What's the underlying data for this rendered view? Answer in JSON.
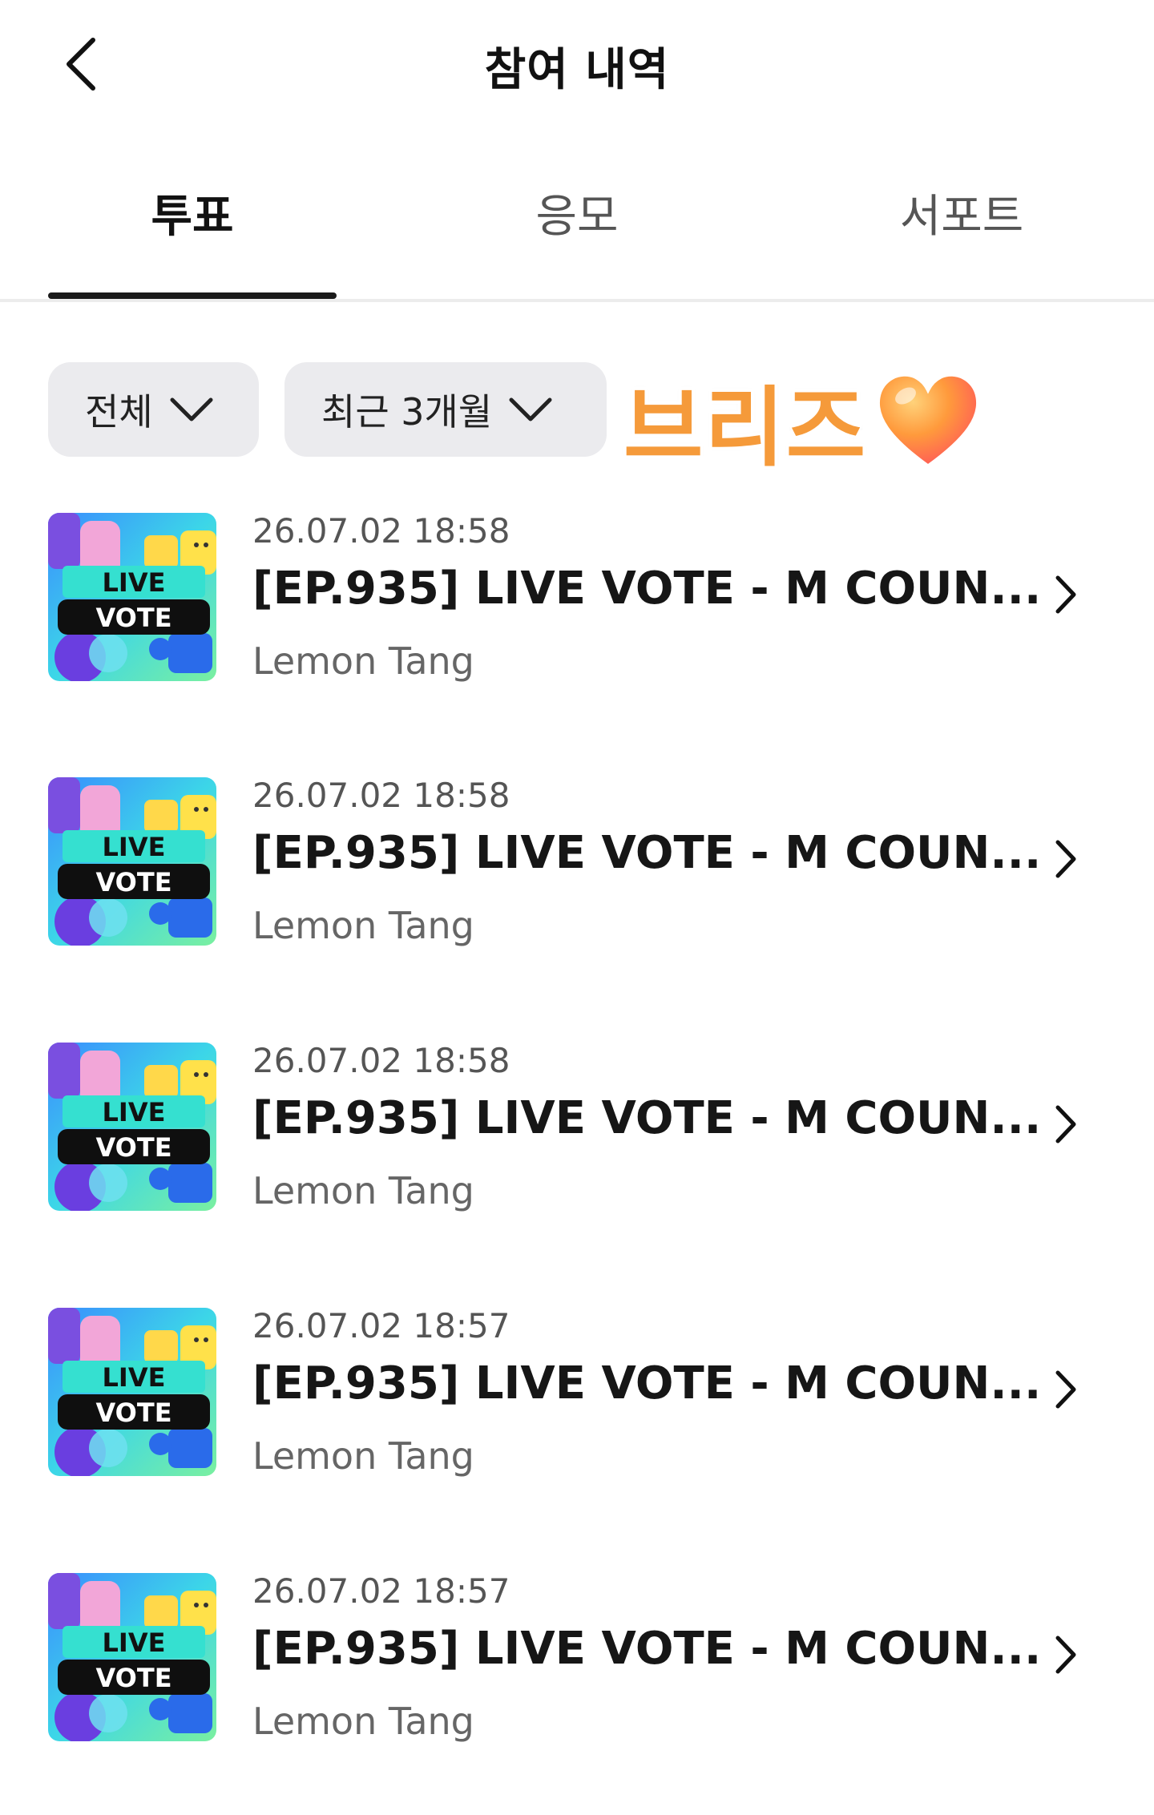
{
  "header": {
    "title": "참여 내역",
    "back_icon": "chevron-left-icon"
  },
  "tabs": [
    {
      "label": "투표",
      "active": true
    },
    {
      "label": "응모",
      "active": false
    },
    {
      "label": "서포트",
      "active": false
    }
  ],
  "filters": {
    "category": {
      "label": "전체",
      "icon": "chevron-down-icon"
    },
    "period": {
      "label": "최근 3개월",
      "icon": "chevron-down-icon"
    }
  },
  "sticker": {
    "text": "브리즈",
    "emoji": "orange-heart"
  },
  "items": [
    {
      "date": "26.07.02 18:58",
      "title": "[EP.935] LIVE VOTE - M COUN...",
      "artist": "Lemon Tang",
      "thumbnail_text": [
        "LIVE",
        "VOTE"
      ]
    },
    {
      "date": "26.07.02 18:58",
      "title": "[EP.935] LIVE VOTE - M COUN...",
      "artist": "Lemon Tang",
      "thumbnail_text": [
        "LIVE",
        "VOTE"
      ]
    },
    {
      "date": "26.07.02 18:58",
      "title": "[EP.935] LIVE VOTE - M COUN...",
      "artist": "Lemon Tang",
      "thumbnail_text": [
        "LIVE",
        "VOTE"
      ]
    },
    {
      "date": "26.07.02 18:57",
      "title": "[EP.935] LIVE VOTE - M COUN...",
      "artist": "Lemon Tang",
      "thumbnail_text": [
        "LIVE",
        "VOTE"
      ]
    },
    {
      "date": "26.07.02 18:57",
      "title": "[EP.935] LIVE VOTE - M COUN...",
      "artist": "Lemon Tang",
      "thumbnail_text": [
        "LIVE",
        "VOTE"
      ]
    }
  ],
  "colors": {
    "active_tab_indicator": "#1a1a1a",
    "chip_background": "#ebebee",
    "sticker_text": "#f59a3a"
  }
}
